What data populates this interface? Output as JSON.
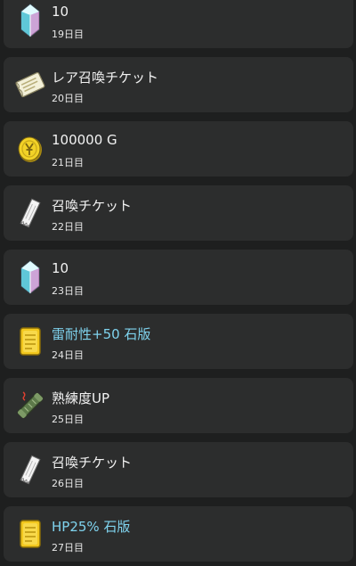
{
  "rewards": [
    {
      "title": "10",
      "day": "19日目",
      "icon": "crystal-icon",
      "title_color": "#f2f2f2"
    },
    {
      "title": "レア召喚チケット",
      "day": "20日目",
      "icon": "rare-summon-ticket-icon",
      "title_color": "#f2f2f2"
    },
    {
      "title": "100000 G",
      "day": "21日目",
      "icon": "gold-coin-icon",
      "title_color": "#f2f2f2"
    },
    {
      "title": "召喚チケット",
      "day": "22日目",
      "icon": "summon-ticket-icon",
      "title_color": "#f2f2f2"
    },
    {
      "title": "10",
      "day": "23日目",
      "icon": "crystal-icon",
      "title_color": "#f2f2f2"
    },
    {
      "title": "雷耐性+50 石版",
      "day": "24日目",
      "icon": "stone-tablet-icon",
      "title_color": "#7fd3ee"
    },
    {
      "title": "熟練度UP",
      "day": "25日目",
      "icon": "proficiency-scroll-icon",
      "title_color": "#f2f2f2"
    },
    {
      "title": "召喚チケット",
      "day": "26日目",
      "icon": "summon-ticket-icon",
      "title_color": "#f2f2f2"
    },
    {
      "title": "HP25% 石版",
      "day": "27日目",
      "icon": "stone-tablet-icon",
      "title_color": "#7fd3ee"
    }
  ]
}
